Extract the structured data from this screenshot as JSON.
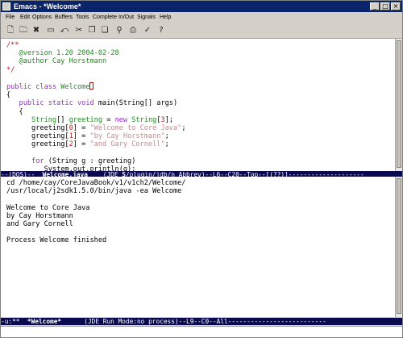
{
  "window": {
    "title": "Emacs - *Welcome*"
  },
  "menu": [
    "File",
    "Edit",
    "Options",
    "Buffers",
    "Tools",
    "Complete",
    "In/Out",
    "Signals",
    "Help"
  ],
  "toolbar": {
    "icons": [
      "open-file-icon",
      "open-directory-icon",
      "close-buffer-icon",
      "save-icon",
      "undo-icon",
      "cut-icon",
      "copy-icon",
      "paste-icon",
      "search-icon",
      "print-icon",
      "spell-check-icon",
      "help-icon"
    ]
  },
  "editor": {
    "lines": [
      [
        [
          "comment",
          "/**"
        ]
      ],
      [
        [
          "comment",
          "   "
        ],
        [
          "doctag",
          "@version 1.20 2004-02-28"
        ]
      ],
      [
        [
          "comment",
          "   "
        ],
        [
          "doctag",
          "@author Cay Horstmann"
        ]
      ],
      [
        [
          "comment",
          "*/"
        ]
      ],
      [],
      [
        [
          "kw",
          "public class "
        ],
        [
          "type",
          "Welcome"
        ],
        [
          "cursor",
          ""
        ]
      ],
      [
        [
          "plain",
          "{"
        ]
      ],
      [
        [
          "plain",
          "   "
        ],
        [
          "kw",
          "public static void "
        ],
        [
          "plain",
          "main(String[] args)"
        ]
      ],
      [
        [
          "plain",
          "   {"
        ]
      ],
      [
        [
          "plain",
          "      "
        ],
        [
          "type",
          "String"
        ],
        [
          "plain",
          "[] "
        ],
        [
          "type",
          "greeting"
        ],
        [
          "plain",
          " = "
        ],
        [
          "kw",
          "new "
        ],
        [
          "type",
          "String"
        ],
        [
          "plain",
          "["
        ],
        [
          "num",
          "3"
        ],
        [
          "plain",
          "];"
        ]
      ],
      [
        [
          "plain",
          "      greeting["
        ],
        [
          "num",
          "0"
        ],
        [
          "plain",
          "] = "
        ],
        [
          "str",
          "\"Welcome to Core Java\""
        ],
        [
          "plain",
          ";"
        ]
      ],
      [
        [
          "plain",
          "      greeting["
        ],
        [
          "num",
          "1"
        ],
        [
          "plain",
          "] = "
        ],
        [
          "str",
          "\"by Cay Horstmann\""
        ],
        [
          "plain",
          ";"
        ]
      ],
      [
        [
          "plain",
          "      greeting["
        ],
        [
          "num",
          "2"
        ],
        [
          "plain",
          "] = "
        ],
        [
          "str",
          "\"and Gary Cornell\""
        ],
        [
          "plain",
          ";"
        ]
      ],
      [],
      [
        [
          "plain",
          "      "
        ],
        [
          "kw",
          "for "
        ],
        [
          "plain",
          "(String g : greeting)"
        ]
      ],
      [
        [
          "plain",
          "         System.out.println(g);"
        ]
      ]
    ]
  },
  "modeline_top": {
    "prefix": "--(DOS)--  ",
    "buffer": "Welcome.java",
    "mid": "    (JDE ",
    "bold_s": "S",
    "rest": "/plugin/jdb/n Abbrev)--L6--C20--Top--[(??)]--------------------"
  },
  "output": {
    "lines": [
      "cd /home/cay/CoreJavaBook/v1/v1ch2/Welcome/",
      "/usr/local/j2sdk1.5.0/bin/java -ea Welcome",
      "",
      "Welcome to Core Java",
      "by Cay Horstmann",
      "and Gary Cornell",
      "",
      "Process Welcome finished"
    ]
  },
  "modeline_bottom": {
    "prefix": "-u:**  ",
    "buffer": "*Welcome*",
    "rest": "      (JDE Run Mode:no process)--L9--C0--All--------------------------"
  }
}
